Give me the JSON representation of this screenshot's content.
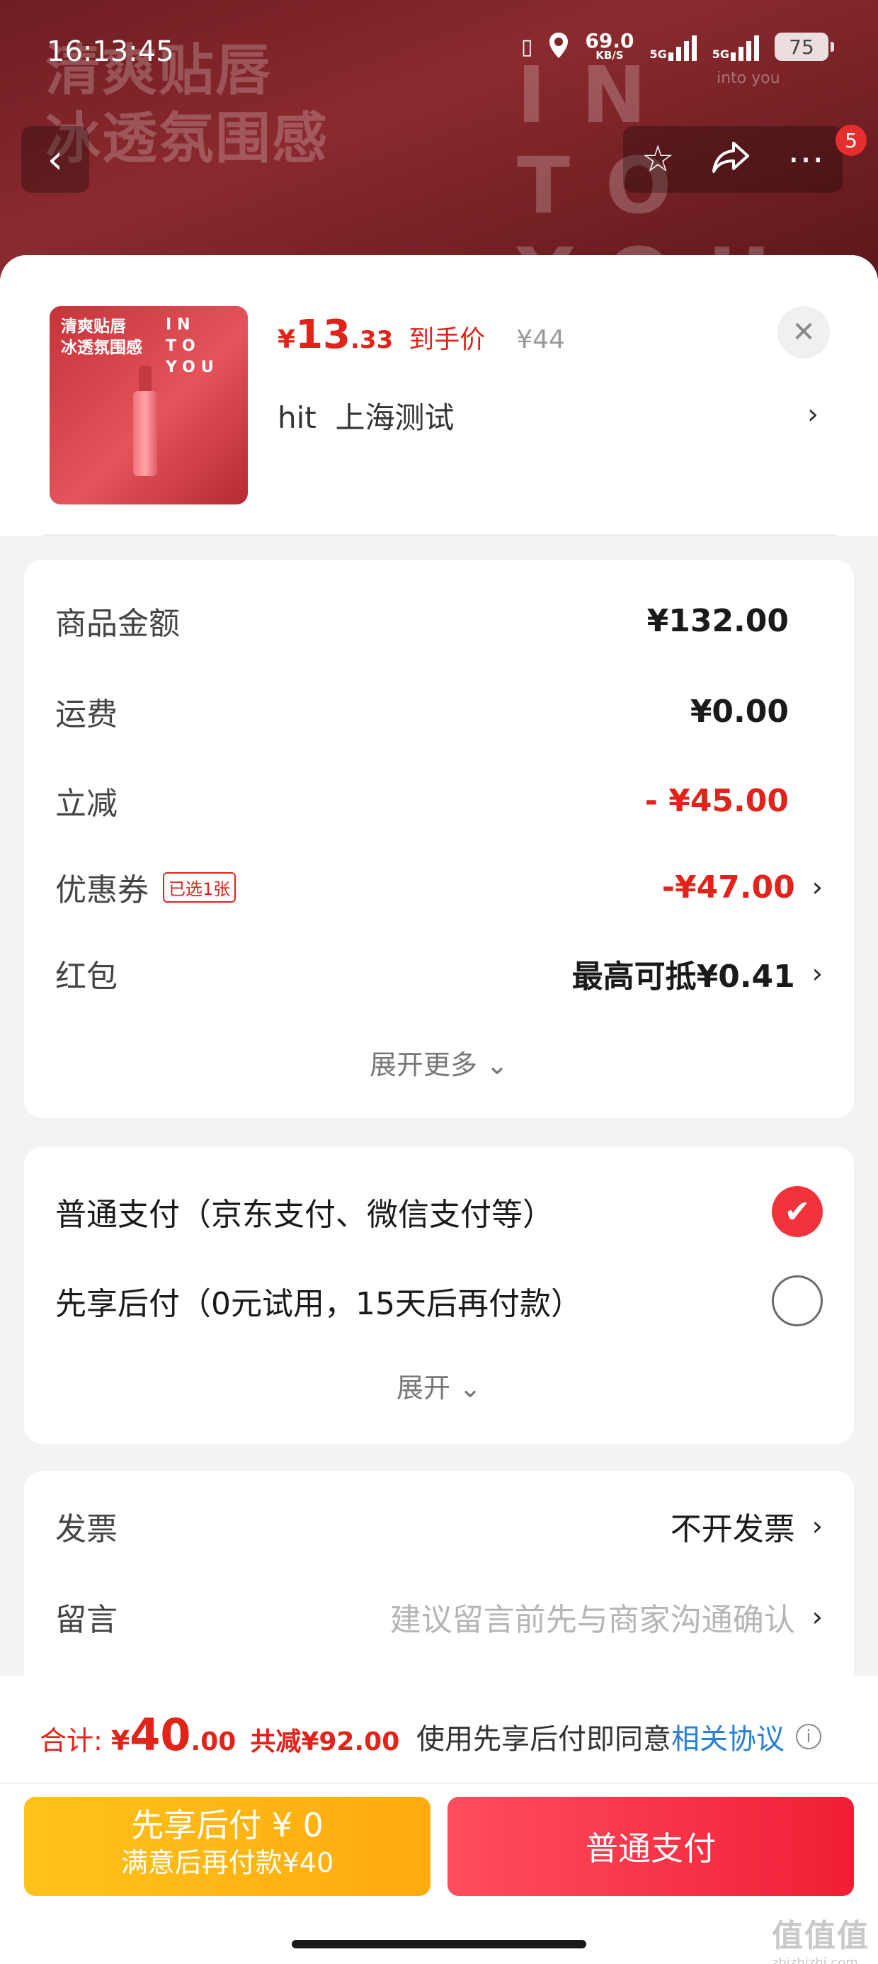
{
  "status_bar": {
    "time": "16:13:45",
    "net_speed": "69.0",
    "net_unit": "KB/S",
    "signal1_label": "5G",
    "signal2_label": "5G",
    "battery": "75"
  },
  "banner": {
    "slogan_line1": "清爽贴唇",
    "slogan_line2": "冰透氛围感",
    "brand_text": "IN TO YOU",
    "brand_small": "into you",
    "badge_count": "5"
  },
  "product": {
    "thumb_slogan_line1": "清爽贴唇",
    "thumb_slogan_line2": "冰透氛围感",
    "thumb_brand_line1": "IN",
    "thumb_brand_line2": "TO YOU",
    "price_currency": "¥",
    "price_int": "13",
    "price_dec": ".33",
    "price_tag": "到手价",
    "original_price": "¥44",
    "name": "hit  上海测试"
  },
  "price_details": {
    "rows": [
      {
        "label": "商品金额",
        "value": "¥132.00"
      },
      {
        "label": "运费",
        "value": "¥0.00"
      },
      {
        "label": "立减",
        "value": "- ¥45.00"
      },
      {
        "label": "优惠券",
        "tag": "已选1张",
        "value": "-¥47.00"
      },
      {
        "label": "红包",
        "value": "最高可抵¥0.41"
      }
    ],
    "expand_label": "展开更多"
  },
  "payment": {
    "options": [
      {
        "label": "普通支付（京东支付、微信支付等）",
        "selected": true
      },
      {
        "label": "先享后付（0元试用，15天后再付款）",
        "selected": false
      }
    ],
    "expand_label": "展开"
  },
  "extras": {
    "rows": [
      {
        "label": "发票",
        "value": "不开发票"
      },
      {
        "label": "留言",
        "value": "建议留言前先与商家沟通确认"
      }
    ]
  },
  "bottom": {
    "total_label": "合计:",
    "total_currency": "¥",
    "total_int": "40",
    "total_dec": ".00",
    "total_reduce": "共减¥92.00",
    "agree_text": "使用先享后付即同意",
    "agree_link": "相关协议",
    "btn_later_line1": "先享后付 ¥ 0",
    "btn_later_line2": "满意后再付款¥40",
    "btn_pay": "普通支付"
  },
  "watermark": {
    "text": "值值值",
    "sub": "zhizhizhi.com"
  },
  "colors": {
    "accent_red": "#e2231a",
    "link_blue": "#2a7fd4",
    "later_button": "#ffb614",
    "pay_button": "#f42c42"
  }
}
